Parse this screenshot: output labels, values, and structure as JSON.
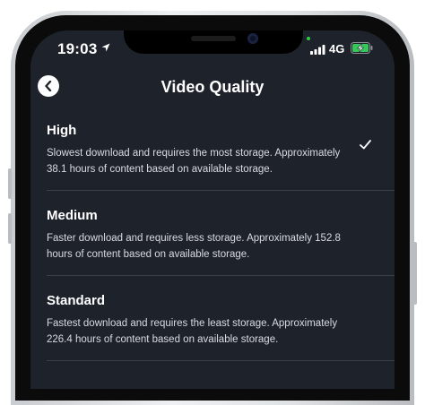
{
  "status_bar": {
    "time": "19:03",
    "network": "4G"
  },
  "nav": {
    "title": "Video Quality"
  },
  "options": [
    {
      "title": "High",
      "description": "Slowest download and requires the most storage. Approximately 38.1 hours of content based on available storage.",
      "selected": true
    },
    {
      "title": "Medium",
      "description": "Faster download and requires less storage. Approximately 152.8 hours of content based on available storage.",
      "selected": false
    },
    {
      "title": "Standard",
      "description": "Fastest download and requires the least storage. Approximately 226.4 hours of content based on available storage.",
      "selected": false
    }
  ],
  "icons": {
    "back": "chevron-left-icon",
    "location": "location-arrow-icon",
    "signal": "cellular-signal-icon",
    "battery": "battery-charging-icon",
    "check": "checkmark-icon"
  },
  "colors": {
    "background": "#1e222b",
    "battery_fill": "#34c759"
  }
}
